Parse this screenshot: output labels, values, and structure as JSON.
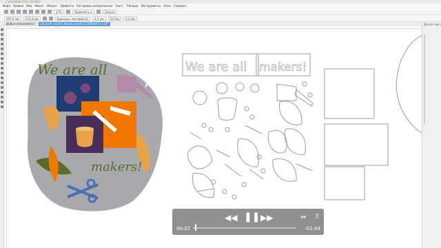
{
  "window": {
    "title": "CorelDRAW 2020 (64-Bit)"
  },
  "menu": {
    "items": [
      "Файл",
      "Правка",
      "Вид",
      "Макет",
      "Объект",
      "Эффекты",
      "Растровые изображения",
      "Текст",
      "Таблица",
      "Инструменты",
      "Окно",
      "Справка"
    ]
  },
  "toolbar": {
    "zoom": "37%",
    "snap_label": "Привязать к",
    "launch_label": "Запуск",
    "units_label": "Единицы: миллиметр",
    "nudge": "0,1 мм",
    "dup_x": "5,0 мм",
    "dup_y": "5,0 мм",
    "size_w": "297,0 мм",
    "size_h": "210,0 мм"
  },
  "tabs": [
    {
      "label": "Добро пожаловать!",
      "active": false
    },
    {
      "label": "clk_laser_vector_diecut_round_2.CDR(ed) [v.1.0]*",
      "active": true
    }
  ],
  "panel": {
    "title": "Диспетчер объектов"
  },
  "artwork": {
    "text_line1": "We are all",
    "text_line2": "makers!",
    "accent_colors": {
      "green": "#5a6b2a",
      "orange": "#f07800",
      "navy": "#1f3d75",
      "purple": "#7a4a7a",
      "tan": "#e9a44a",
      "gray": "#a7a9ac",
      "blue": "#4a6fb5",
      "lilac": "#b48aa8"
    }
  },
  "video": {
    "elapsed": "00:02",
    "remaining": "-01:49",
    "progress": 0.018
  }
}
